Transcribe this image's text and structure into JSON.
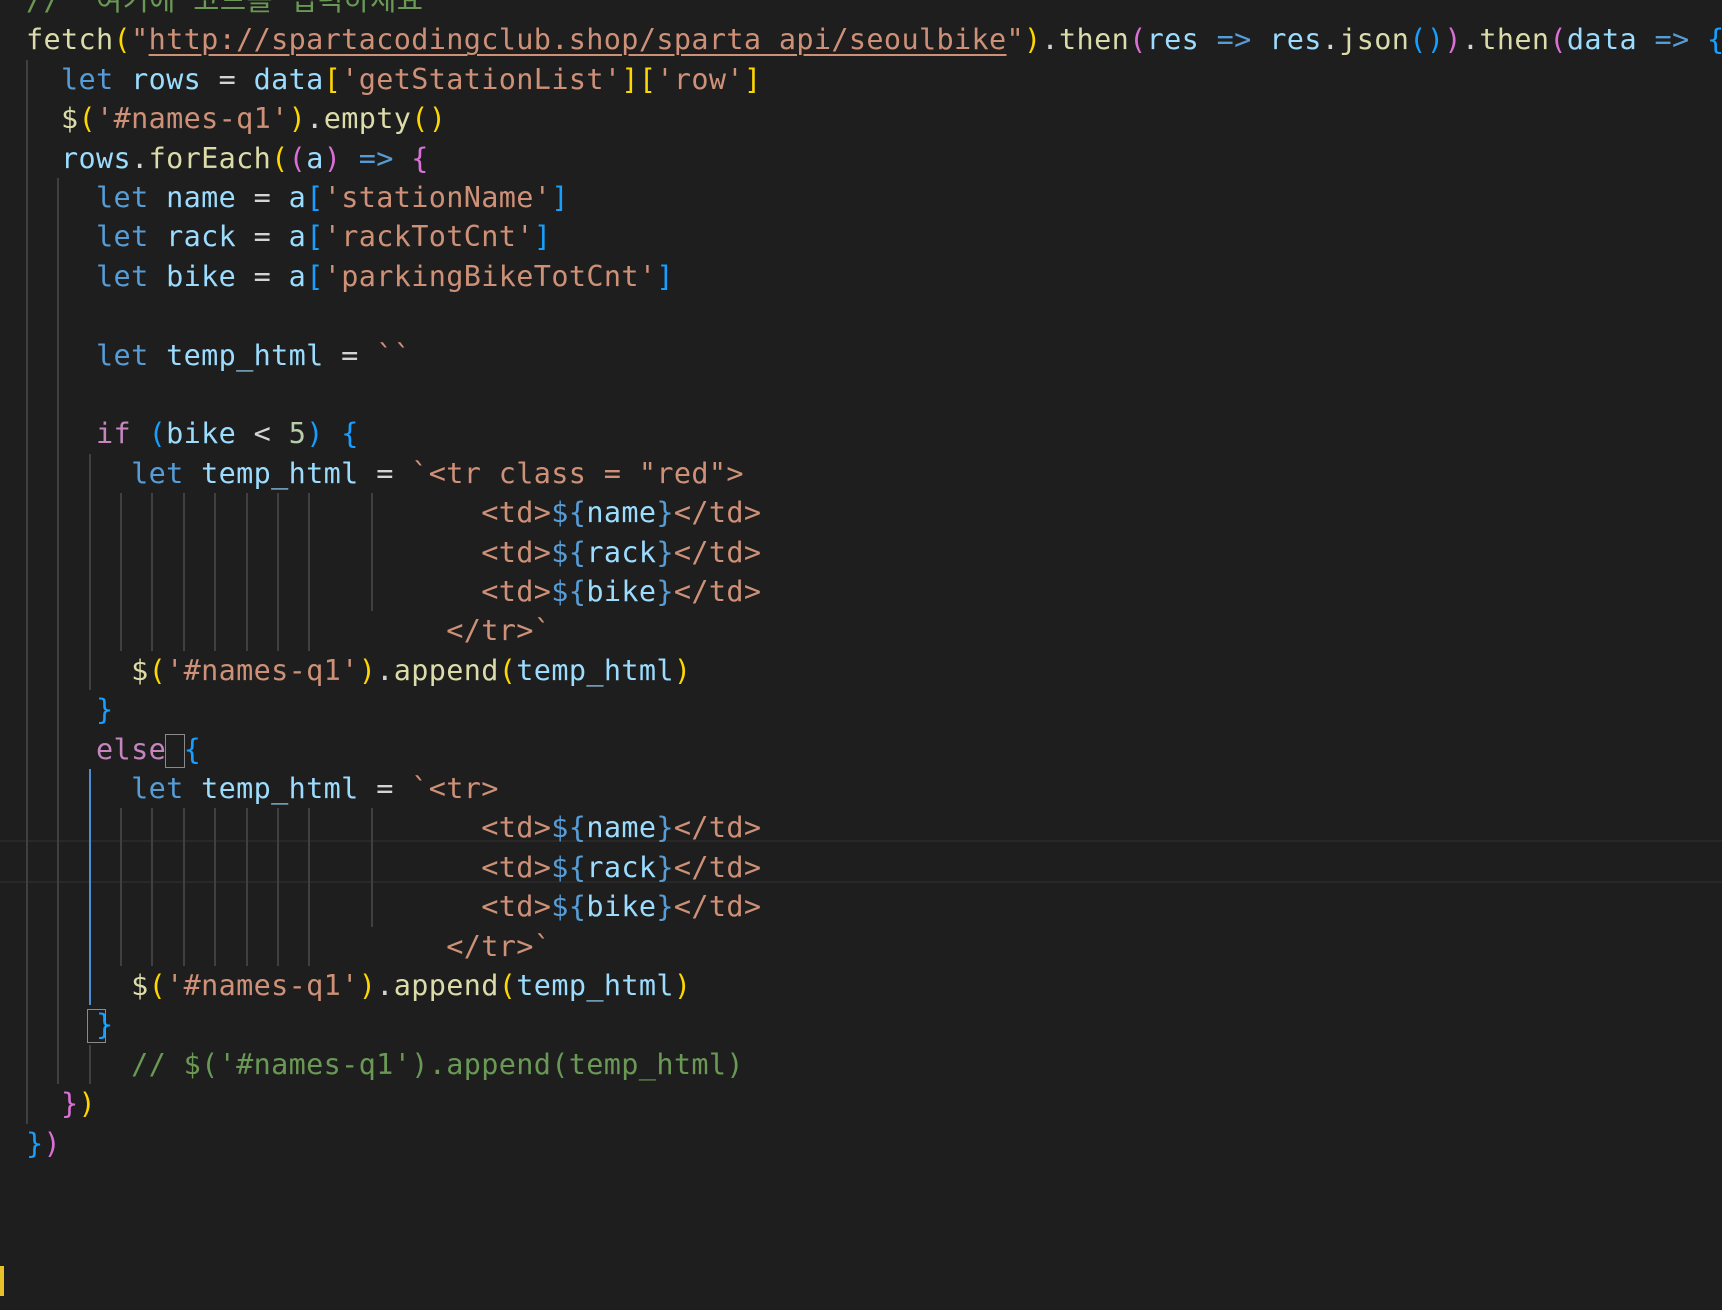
{
  "theme": {
    "background": "#1e1e1e",
    "keyword": "#569cd6",
    "control": "#c586c0",
    "variable": "#9cdcfe",
    "function": "#dcdcaa",
    "string": "#ce9178",
    "number": "#b5cea8",
    "comment": "#6a9955",
    "bracket_gold": "#ffd700",
    "bracket_purple": "#da70d6",
    "bracket_blue": "#179fff",
    "plain": "#d4d4d4"
  },
  "code": {
    "lines": [
      [
        {
          "t": "//  여기에 코드를 입력하세요",
          "c": "comment"
        }
      ],
      [
        {
          "t": "fetch",
          "c": "function"
        },
        {
          "t": "(",
          "c": "bracket_gold"
        },
        {
          "t": "\"",
          "c": "string"
        },
        {
          "t": "http://spartacodingclub.shop/sparta_api/seoulbike",
          "c": "string",
          "u": true
        },
        {
          "t": "\"",
          "c": "string"
        },
        {
          "t": ")",
          "c": "bracket_gold"
        },
        {
          "t": ".",
          "c": "plain"
        },
        {
          "t": "then",
          "c": "function"
        },
        {
          "t": "(",
          "c": "bracket_purple"
        },
        {
          "t": "res",
          "c": "variable"
        },
        {
          "t": " ",
          "c": "plain"
        },
        {
          "t": "=>",
          "c": "keyword"
        },
        {
          "t": " ",
          "c": "plain"
        },
        {
          "t": "res",
          "c": "variable"
        },
        {
          "t": ".",
          "c": "plain"
        },
        {
          "t": "json",
          "c": "function"
        },
        {
          "t": "(",
          "c": "bracket_blue"
        },
        {
          "t": ")",
          "c": "bracket_blue"
        },
        {
          "t": ")",
          "c": "bracket_purple"
        },
        {
          "t": ".",
          "c": "plain"
        },
        {
          "t": "then",
          "c": "function"
        },
        {
          "t": "(",
          "c": "bracket_purple"
        },
        {
          "t": "data",
          "c": "variable"
        },
        {
          "t": " ",
          "c": "plain"
        },
        {
          "t": "=>",
          "c": "keyword"
        },
        {
          "t": " ",
          "c": "plain"
        },
        {
          "t": "{",
          "c": "bracket_blue"
        }
      ],
      [
        {
          "t": "  ",
          "c": "plain"
        },
        {
          "t": "let",
          "c": "keyword"
        },
        {
          "t": " ",
          "c": "plain"
        },
        {
          "t": "rows",
          "c": "variable"
        },
        {
          "t": " = ",
          "c": "plain"
        },
        {
          "t": "data",
          "c": "variable"
        },
        {
          "t": "[",
          "c": "bracket_gold"
        },
        {
          "t": "'getStationList'",
          "c": "string"
        },
        {
          "t": "]",
          "c": "bracket_gold"
        },
        {
          "t": "[",
          "c": "bracket_gold"
        },
        {
          "t": "'row'",
          "c": "string"
        },
        {
          "t": "]",
          "c": "bracket_gold"
        }
      ],
      [
        {
          "t": "  ",
          "c": "plain"
        },
        {
          "t": "$",
          "c": "function"
        },
        {
          "t": "(",
          "c": "bracket_gold"
        },
        {
          "t": "'#names-q1'",
          "c": "string"
        },
        {
          "t": ")",
          "c": "bracket_gold"
        },
        {
          "t": ".",
          "c": "plain"
        },
        {
          "t": "empty",
          "c": "function"
        },
        {
          "t": "(",
          "c": "bracket_gold"
        },
        {
          "t": ")",
          "c": "bracket_gold"
        }
      ],
      [
        {
          "t": "  ",
          "c": "plain"
        },
        {
          "t": "rows",
          "c": "variable"
        },
        {
          "t": ".",
          "c": "plain"
        },
        {
          "t": "forEach",
          "c": "function"
        },
        {
          "t": "(",
          "c": "bracket_gold"
        },
        {
          "t": "(",
          "c": "bracket_purple"
        },
        {
          "t": "a",
          "c": "variable"
        },
        {
          "t": ")",
          "c": "bracket_purple"
        },
        {
          "t": " ",
          "c": "plain"
        },
        {
          "t": "=>",
          "c": "keyword"
        },
        {
          "t": " ",
          "c": "plain"
        },
        {
          "t": "{",
          "c": "bracket_purple"
        }
      ],
      [
        {
          "t": "    ",
          "c": "plain"
        },
        {
          "t": "let",
          "c": "keyword"
        },
        {
          "t": " ",
          "c": "plain"
        },
        {
          "t": "name",
          "c": "variable"
        },
        {
          "t": " = ",
          "c": "plain"
        },
        {
          "t": "a",
          "c": "variable"
        },
        {
          "t": "[",
          "c": "bracket_blue"
        },
        {
          "t": "'stationName'",
          "c": "string"
        },
        {
          "t": "]",
          "c": "bracket_blue"
        }
      ],
      [
        {
          "t": "    ",
          "c": "plain"
        },
        {
          "t": "let",
          "c": "keyword"
        },
        {
          "t": " ",
          "c": "plain"
        },
        {
          "t": "rack",
          "c": "variable"
        },
        {
          "t": " = ",
          "c": "plain"
        },
        {
          "t": "a",
          "c": "variable"
        },
        {
          "t": "[",
          "c": "bracket_blue"
        },
        {
          "t": "'rackTotCnt'",
          "c": "string"
        },
        {
          "t": "]",
          "c": "bracket_blue"
        }
      ],
      [
        {
          "t": "    ",
          "c": "plain"
        },
        {
          "t": "let",
          "c": "keyword"
        },
        {
          "t": " ",
          "c": "plain"
        },
        {
          "t": "bike",
          "c": "variable"
        },
        {
          "t": " = ",
          "c": "plain"
        },
        {
          "t": "a",
          "c": "variable"
        },
        {
          "t": "[",
          "c": "bracket_blue"
        },
        {
          "t": "'parkingBikeTotCnt'",
          "c": "string"
        },
        {
          "t": "]",
          "c": "bracket_blue"
        }
      ],
      [],
      [
        {
          "t": "    ",
          "c": "plain"
        },
        {
          "t": "let",
          "c": "keyword"
        },
        {
          "t": " ",
          "c": "plain"
        },
        {
          "t": "temp_html",
          "c": "variable"
        },
        {
          "t": " = ",
          "c": "plain"
        },
        {
          "t": "``",
          "c": "string"
        }
      ],
      [],
      [
        {
          "t": "    ",
          "c": "plain"
        },
        {
          "t": "if",
          "c": "control"
        },
        {
          "t": " ",
          "c": "plain"
        },
        {
          "t": "(",
          "c": "bracket_blue"
        },
        {
          "t": "bike",
          "c": "variable"
        },
        {
          "t": " < ",
          "c": "plain"
        },
        {
          "t": "5",
          "c": "number"
        },
        {
          "t": ")",
          "c": "bracket_blue"
        },
        {
          "t": " ",
          "c": "plain"
        },
        {
          "t": "{",
          "c": "bracket_blue"
        }
      ],
      [
        {
          "t": "      ",
          "c": "plain"
        },
        {
          "t": "let",
          "c": "keyword"
        },
        {
          "t": " ",
          "c": "plain"
        },
        {
          "t": "temp_html",
          "c": "variable"
        },
        {
          "t": " = ",
          "c": "plain"
        },
        {
          "t": "`<tr class = \"red\">",
          "c": "string"
        }
      ],
      [
        {
          "t": "                          ",
          "c": "plain"
        },
        {
          "t": "<td>",
          "c": "string"
        },
        {
          "t": "${",
          "c": "keyword"
        },
        {
          "t": "name",
          "c": "variable"
        },
        {
          "t": "}",
          "c": "keyword"
        },
        {
          "t": "</td>",
          "c": "string"
        }
      ],
      [
        {
          "t": "                          ",
          "c": "plain"
        },
        {
          "t": "<td>",
          "c": "string"
        },
        {
          "t": "${",
          "c": "keyword"
        },
        {
          "t": "rack",
          "c": "variable"
        },
        {
          "t": "}",
          "c": "keyword"
        },
        {
          "t": "</td>",
          "c": "string"
        }
      ],
      [
        {
          "t": "                          ",
          "c": "plain"
        },
        {
          "t": "<td>",
          "c": "string"
        },
        {
          "t": "${",
          "c": "keyword"
        },
        {
          "t": "bike",
          "c": "variable"
        },
        {
          "t": "}",
          "c": "keyword"
        },
        {
          "t": "</td>",
          "c": "string"
        }
      ],
      [
        {
          "t": "                        ",
          "c": "plain"
        },
        {
          "t": "</tr>`",
          "c": "string"
        }
      ],
      [
        {
          "t": "      ",
          "c": "plain"
        },
        {
          "t": "$",
          "c": "function"
        },
        {
          "t": "(",
          "c": "bracket_gold"
        },
        {
          "t": "'#names-q1'",
          "c": "string"
        },
        {
          "t": ")",
          "c": "bracket_gold"
        },
        {
          "t": ".",
          "c": "plain"
        },
        {
          "t": "append",
          "c": "function"
        },
        {
          "t": "(",
          "c": "bracket_gold"
        },
        {
          "t": "temp_html",
          "c": "variable"
        },
        {
          "t": ")",
          "c": "bracket_gold"
        }
      ],
      [
        {
          "t": "    ",
          "c": "plain"
        },
        {
          "t": "}",
          "c": "bracket_blue"
        }
      ],
      [
        {
          "t": "    ",
          "c": "plain"
        },
        {
          "t": "else",
          "c": "control"
        },
        {
          "t": " ",
          "c": "plain"
        },
        {
          "t": "{",
          "c": "bracket_blue"
        }
      ],
      [
        {
          "t": "      ",
          "c": "plain"
        },
        {
          "t": "let",
          "c": "keyword"
        },
        {
          "t": " ",
          "c": "plain"
        },
        {
          "t": "temp_html",
          "c": "variable"
        },
        {
          "t": " = ",
          "c": "plain"
        },
        {
          "t": "`<tr>",
          "c": "string"
        }
      ],
      [
        {
          "t": "                          ",
          "c": "plain"
        },
        {
          "t": "<td>",
          "c": "string"
        },
        {
          "t": "${",
          "c": "keyword"
        },
        {
          "t": "name",
          "c": "variable"
        },
        {
          "t": "}",
          "c": "keyword"
        },
        {
          "t": "</td>",
          "c": "string"
        }
      ],
      [
        {
          "t": "                          ",
          "c": "plain"
        },
        {
          "t": "<td>",
          "c": "string"
        },
        {
          "t": "${",
          "c": "keyword"
        },
        {
          "t": "rack",
          "c": "variable"
        },
        {
          "t": "}",
          "c": "keyword"
        },
        {
          "t": "</td>",
          "c": "string"
        }
      ],
      [
        {
          "t": "                          ",
          "c": "plain"
        },
        {
          "t": "<td>",
          "c": "string"
        },
        {
          "t": "${",
          "c": "keyword"
        },
        {
          "t": "bike",
          "c": "variable"
        },
        {
          "t": "}",
          "c": "keyword"
        },
        {
          "t": "</td>",
          "c": "string"
        }
      ],
      [
        {
          "t": "                        ",
          "c": "plain"
        },
        {
          "t": "</tr>`",
          "c": "string"
        }
      ],
      [
        {
          "t": "      ",
          "c": "plain"
        },
        {
          "t": "$",
          "c": "function"
        },
        {
          "t": "(",
          "c": "bracket_gold"
        },
        {
          "t": "'#names-q1'",
          "c": "string"
        },
        {
          "t": ")",
          "c": "bracket_gold"
        },
        {
          "t": ".",
          "c": "plain"
        },
        {
          "t": "append",
          "c": "function"
        },
        {
          "t": "(",
          "c": "bracket_gold"
        },
        {
          "t": "temp_html",
          "c": "variable"
        },
        {
          "t": ")",
          "c": "bracket_gold"
        }
      ],
      [
        {
          "t": "    ",
          "c": "plain"
        },
        {
          "t": "}",
          "c": "bracket_blue"
        }
      ],
      [
        {
          "t": "      ",
          "c": "plain"
        },
        {
          "t": "// $('#names-q1').append(temp_html)",
          "c": "comment"
        }
      ],
      [
        {
          "t": "  ",
          "c": "plain"
        },
        {
          "t": "}",
          "c": "bracket_purple"
        },
        {
          "t": ")",
          "c": "bracket_gold"
        }
      ],
      [
        {
          "t": "}",
          "c": "bracket_blue"
        },
        {
          "t": ")",
          "c": "bracket_purple"
        }
      ]
    ]
  }
}
